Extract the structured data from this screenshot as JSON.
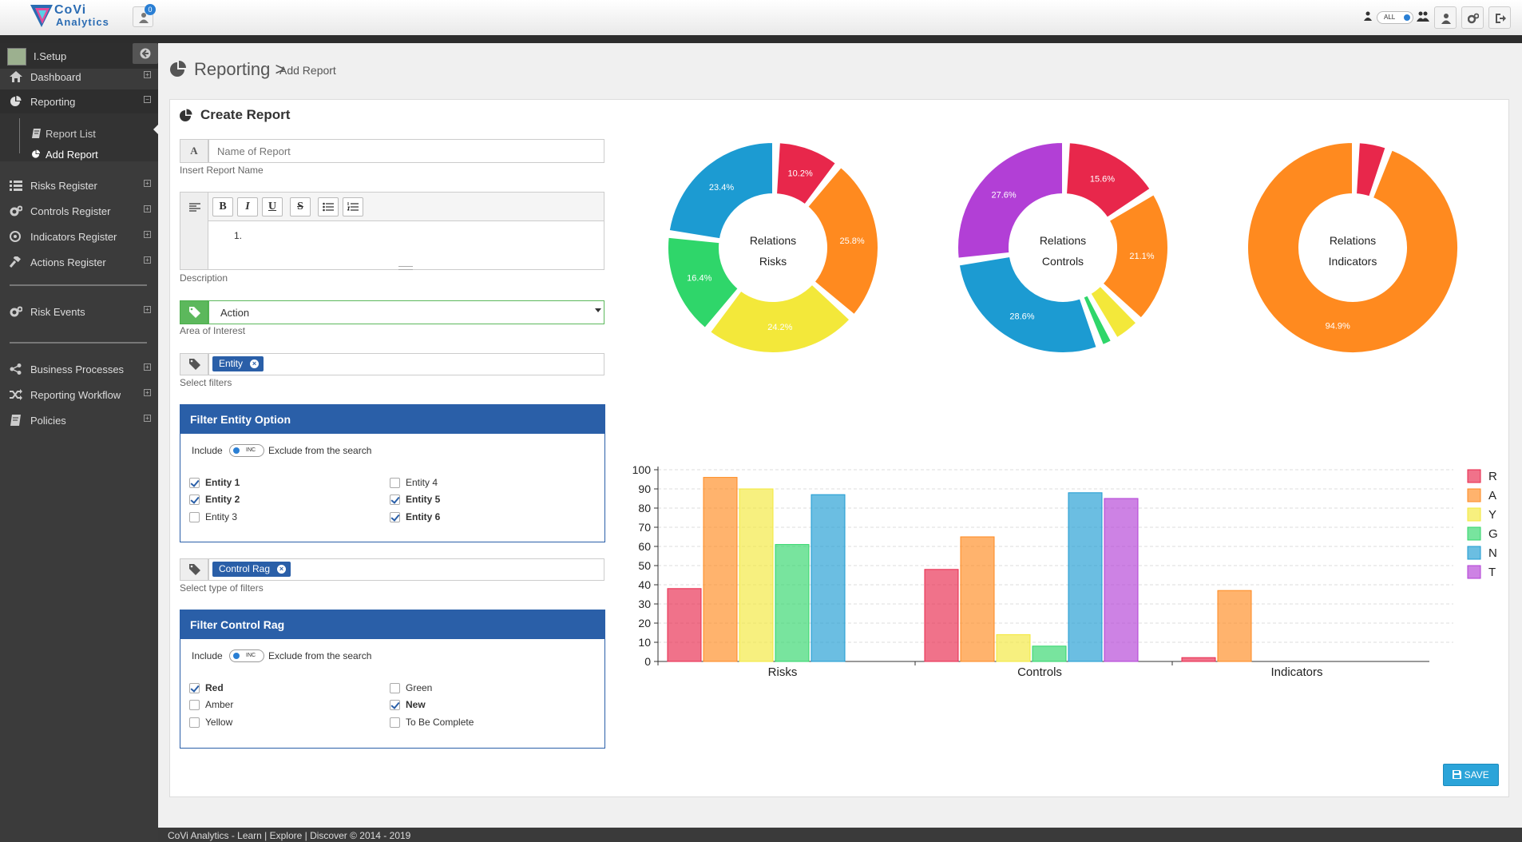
{
  "app": {
    "logo_line1": "CoVi",
    "logo_line2": "Analytics",
    "notification_count": "0",
    "scope_toggle_label": "ALL"
  },
  "sidebar": {
    "username": "I.Setup",
    "items": [
      {
        "label": "Dashboard",
        "icon": "home-icon"
      },
      {
        "label": "Reporting",
        "icon": "pie-chart-icon"
      },
      {
        "label": "Risks Register",
        "icon": "list-icon"
      },
      {
        "label": "Controls Register",
        "icon": "gears-icon"
      },
      {
        "label": "Indicators Register",
        "icon": "target-icon"
      },
      {
        "label": "Actions Register",
        "icon": "gavel-icon"
      },
      {
        "label": "Risk Events",
        "icon": "gears-icon"
      },
      {
        "label": "Business Processes",
        "icon": "share-icon"
      },
      {
        "label": "Reporting Workflow",
        "icon": "shuffle-icon"
      },
      {
        "label": "Policies",
        "icon": "book-icon"
      }
    ],
    "subitems": [
      {
        "label": "Report List",
        "icon": "book-icon"
      },
      {
        "label": "Add Report",
        "icon": "pie-chart-icon"
      }
    ]
  },
  "page": {
    "title": "Reporting >",
    "subtitle": "Add Report",
    "panel_title": "Create Report"
  },
  "form": {
    "name_addon": "A",
    "name_placeholder": "Name of Report",
    "name_help": "Insert Report Name",
    "editor_buttons": [
      "B",
      "I",
      "U",
      "S"
    ],
    "editor_content": "1.",
    "description_help": "Description",
    "area_value": "Action",
    "area_help": "Area of Interest",
    "filter_tag": "Entity",
    "filter_help": "Select filters",
    "filter_type_tag": "Control Rag",
    "filter_type_help": "Select type of filters",
    "include_label": "Include",
    "exclude_label": "Exclude from the search",
    "switch_label": "INC",
    "entity_box": {
      "title": "Filter Entity Option",
      "options": [
        {
          "label": "Entity 1",
          "checked": true
        },
        {
          "label": "Entity 2",
          "checked": true
        },
        {
          "label": "Entity 3",
          "checked": false
        },
        {
          "label": "Entity 4",
          "checked": false
        },
        {
          "label": "Entity 5",
          "checked": true
        },
        {
          "label": "Entity 6",
          "checked": true
        }
      ]
    },
    "rag_box": {
      "title": "Filter Control Rag",
      "options": [
        {
          "label": "Red",
          "checked": true
        },
        {
          "label": "Amber",
          "checked": false
        },
        {
          "label": "Yellow",
          "checked": false
        },
        {
          "label": "Green",
          "checked": false
        },
        {
          "label": "New",
          "checked": true
        },
        {
          "label": "To Be Complete",
          "checked": false
        }
      ]
    },
    "save_label": "SAVE"
  },
  "colors": {
    "R": "#e8274b",
    "A": "#ff8a1f",
    "Y": "#f3e83a",
    "G": "#2fd66a",
    "N": "#1c9bd2",
    "T": "#b23fd6"
  },
  "chart_data": [
    {
      "type": "pie",
      "title": "Relations Risks",
      "center_lines": [
        "Relations",
        "Risks"
      ],
      "slices": [
        {
          "label": "R",
          "value": 10.2
        },
        {
          "label": "A",
          "value": 25.8
        },
        {
          "label": "Y",
          "value": 24.2
        },
        {
          "label": "G",
          "value": 16.4
        },
        {
          "label": "N",
          "value": 23.4
        }
      ]
    },
    {
      "type": "pie",
      "title": "Relations Controls",
      "center_lines": [
        "Relations",
        "Controls"
      ],
      "slices": [
        {
          "label": "R",
          "value": 15.6
        },
        {
          "label": "A",
          "value": 21.1
        },
        {
          "label": "Y",
          "value": 4.7
        },
        {
          "label": "G",
          "value": 2.4
        },
        {
          "label": "N",
          "value": 28.6
        },
        {
          "label": "T",
          "value": 27.6
        }
      ]
    },
    {
      "type": "pie",
      "title": "Relations Indicators",
      "center_lines": [
        "Relations",
        "Indicators"
      ],
      "slices": [
        {
          "label": "R",
          "value": 5.1
        },
        {
          "label": "A",
          "value": 94.9
        }
      ]
    },
    {
      "type": "bar",
      "categories": [
        "Risks",
        "Controls",
        "Indicators"
      ],
      "ylim": [
        0,
        100
      ],
      "yticks": [
        0,
        10,
        20,
        30,
        40,
        50,
        60,
        70,
        80,
        90,
        100
      ],
      "legend": "right",
      "grid": true,
      "series": [
        {
          "name": "R",
          "values": [
            38,
            48,
            2
          ]
        },
        {
          "name": "A",
          "values": [
            96,
            65,
            37
          ]
        },
        {
          "name": "Y",
          "values": [
            90,
            14,
            0
          ]
        },
        {
          "name": "G",
          "values": [
            61,
            8,
            0
          ]
        },
        {
          "name": "N",
          "values": [
            87,
            88,
            0
          ]
        },
        {
          "name": "T",
          "values": [
            0,
            85,
            0
          ]
        }
      ]
    }
  ],
  "footer": {
    "text": "CoVi Analytics - Learn | Explore | Discover © 2014 - 2019"
  }
}
